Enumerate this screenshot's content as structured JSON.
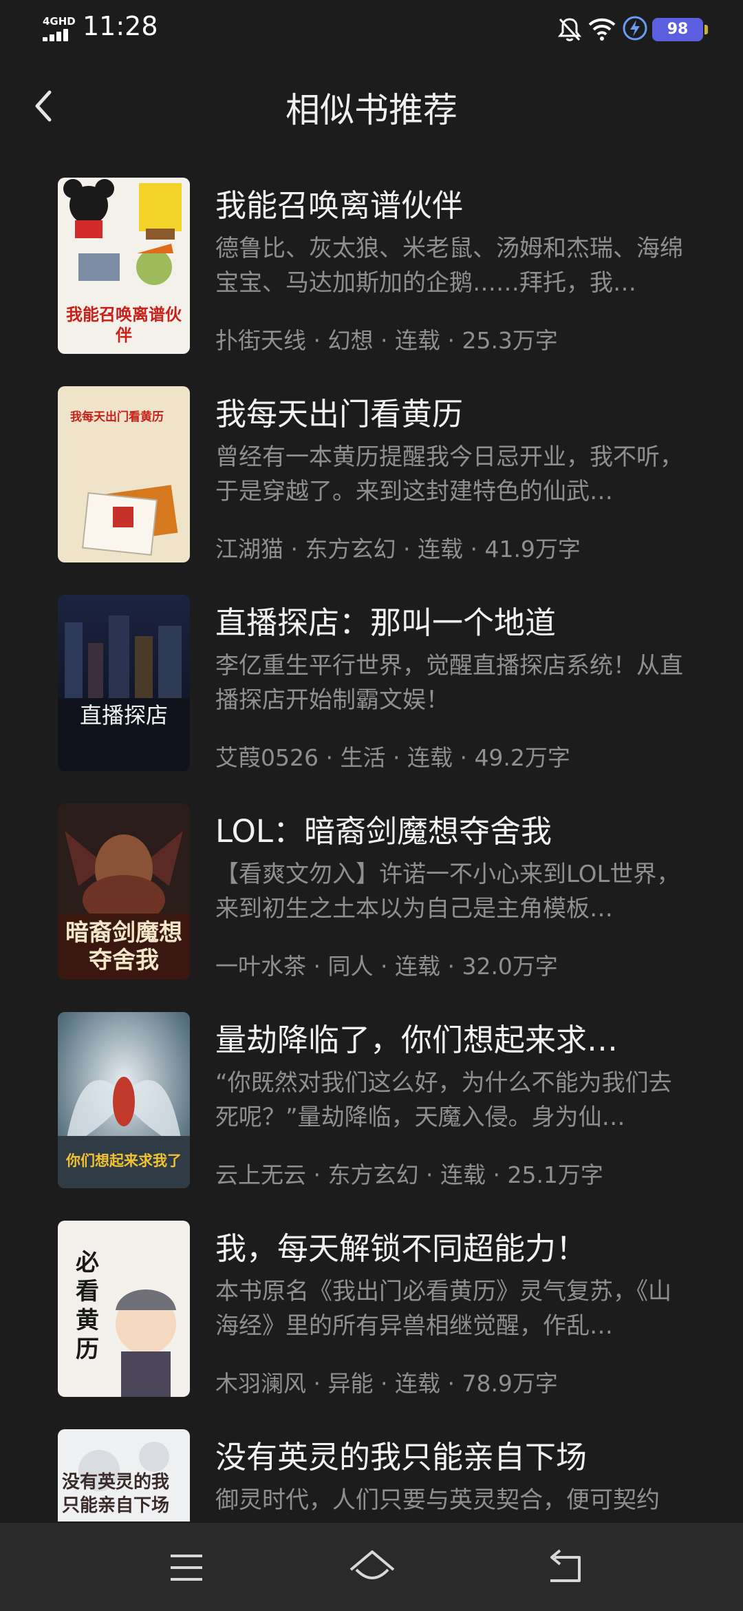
{
  "status_bar": {
    "network": "4GHD",
    "time": "11:28",
    "battery": "98"
  },
  "header": {
    "title": "相似书推荐"
  },
  "books": [
    {
      "title": "我能召唤离谱伙伴",
      "desc": "德鲁比、灰太狼、米老鼠、汤姆和杰瑞、海绵宝宝、马达加斯加的企鹅……拜托，我…",
      "author": "扑街天线",
      "genre": "幻想",
      "status": "连载",
      "words": "25.3万字",
      "cover_text": "我能召唤离谱伙伴"
    },
    {
      "title": "我每天出门看黄历",
      "desc": "曾经有一本黄历提醒我今日忌开业，我不听，于是穿越了。来到这封建特色的仙武…",
      "author": "江湖猫",
      "genre": "东方玄幻",
      "status": "连载",
      "words": "41.9万字",
      "cover_text": "我每天出门看黄历"
    },
    {
      "title": "直播探店：那叫一个地道",
      "desc": "李亿重生平行世界，觉醒直播探店系统！从直播探店开始制霸文娱！",
      "author": "艾葭0526",
      "genre": "生活",
      "status": "连载",
      "words": "49.2万字",
      "cover_text": "直播探店"
    },
    {
      "title": "LOL：暗裔剑魔想夺舍我",
      "desc": "【看爽文勿入】许诺一不小心来到LOL世界，来到初生之土本以为自己是主角模板…",
      "author": "一叶水茶",
      "genre": "同人",
      "status": "连载",
      "words": "32.0万字",
      "cover_text": "暗裔剑魔想夺舍我"
    },
    {
      "title": "量劫降临了，你们想起来求…",
      "desc": "“你既然对我们这么好，为什么不能为我们去死呢？”量劫降临，天魔入侵。身为仙…",
      "author": "云上无云",
      "genre": "东方玄幻",
      "status": "连载",
      "words": "25.1万字",
      "cover_text": "你们想起来求我了"
    },
    {
      "title": "我，每天解锁不同超能力！",
      "desc": "本书原名《我出门必看黄历》灵气复苏，《山海经》里的所有异兽相继觉醒，作乱…",
      "author": "木羽澜风",
      "genre": "异能",
      "status": "连载",
      "words": "78.9万字",
      "cover_text": "必看黄历"
    },
    {
      "title": "没有英灵的我只能亲自下场",
      "desc": "御灵时代，人们只要与英灵契合，便可契约",
      "author": "",
      "genre": "",
      "status": "",
      "words": "",
      "cover_text": "没有英灵的我只能亲自下场"
    }
  ],
  "meta_separator": " · ",
  "icons": {
    "back": "chevron-left-icon",
    "mute": "bell-off-icon",
    "wifi": "wifi-icon",
    "charging": "lightning-icon",
    "menu": "menu-icon",
    "home": "home-icon",
    "return": "return-icon"
  }
}
